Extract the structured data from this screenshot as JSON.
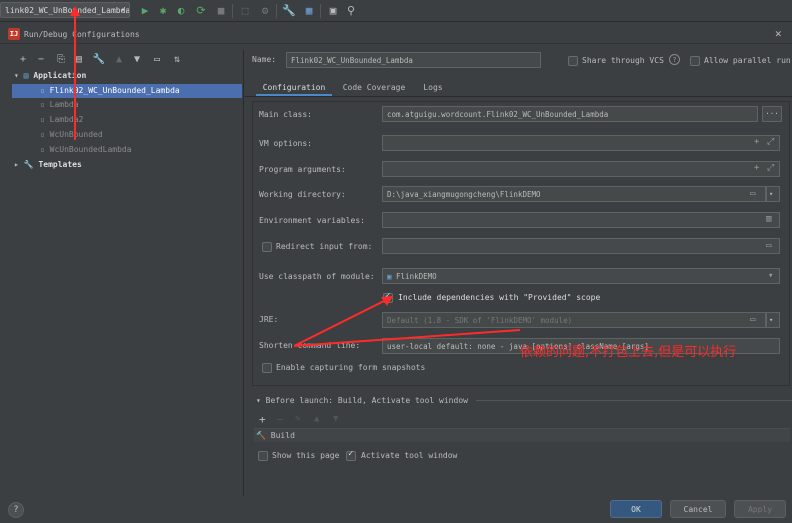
{
  "toolbar": {
    "run_config": "link02_WC_UnBounded_Lambda",
    "icons": [
      "run-icon",
      "debug-icon",
      "coverage-icon",
      "profile-icon",
      "stop-icon",
      "build-icon",
      "sdk-icon",
      "settings-icon",
      "project-structure-icon",
      "layout-icon",
      "search-icon"
    ]
  },
  "dialog": {
    "title": "Run/Debug Configurations",
    "help": "?"
  },
  "tree": {
    "toolbar_icons": [
      "+",
      "−",
      "⎘",
      "💾",
      "🔧",
      "▲",
      "▼",
      "⇅",
      "⇵"
    ],
    "items": [
      {
        "label": "Application",
        "kind": "group"
      },
      {
        "label": "Flink02_WC_UnBounded_Lambda",
        "kind": "config"
      },
      {
        "label": "Lambda",
        "kind": "config"
      },
      {
        "label": "Lambda2",
        "kind": "config"
      },
      {
        "label": "WcUnBounded",
        "kind": "config"
      },
      {
        "label": "WcUnBoundedLambda",
        "kind": "config"
      },
      {
        "label": "Templates",
        "kind": "group"
      }
    ]
  },
  "header": {
    "name_label": "Name:",
    "name_value": "Flink02_WC_UnBounded_Lambda",
    "share_vcs": "Share through VCS",
    "allow_parallel": "Allow parallel run"
  },
  "tabs": [
    "Configuration",
    "Code Coverage",
    "Logs"
  ],
  "form": {
    "main_class_label": "Main class:",
    "main_class_value": "com.atguigu.wordcount.Flink02_WC_UnBounded_Lambda",
    "vm_options_label": "VM options:",
    "program_args_label": "Program arguments:",
    "working_dir_label": "Working directory:",
    "working_dir_value": "D:\\java_xiangmugongcheng\\FlinkDEMO",
    "env_vars_label": "Environment variables:",
    "redirect_label": "Redirect input from:",
    "classpath_label": "Use classpath of module:",
    "classpath_value": "FlinkDEMO",
    "include_deps_label": "Include dependencies with \"Provided\" scope",
    "jre_label": "JRE:",
    "jre_value": "Default (1.8 - SDK of 'FlinkDEMO' module)",
    "shorten_label": "Shorten command line:",
    "shorten_value": "user-local default: none - java [options] className [args]",
    "capture_label": "Enable capturing form snapshots"
  },
  "before_launch": {
    "title": "Before launch: Build, Activate tool window",
    "task": "Build",
    "show_page": "Show this page",
    "activate_tool": "Activate tool window"
  },
  "buttons": {
    "ok": "OK",
    "cancel": "Cancel",
    "apply": "Apply"
  },
  "annotation": {
    "text": "依赖的问题,不打包上去,但是可以执行",
    "color": "#ff2a2a"
  },
  "colors": {
    "selection": "#4b6eaf",
    "ok_button": "#365880",
    "tab_underline": "#4a88c7"
  }
}
